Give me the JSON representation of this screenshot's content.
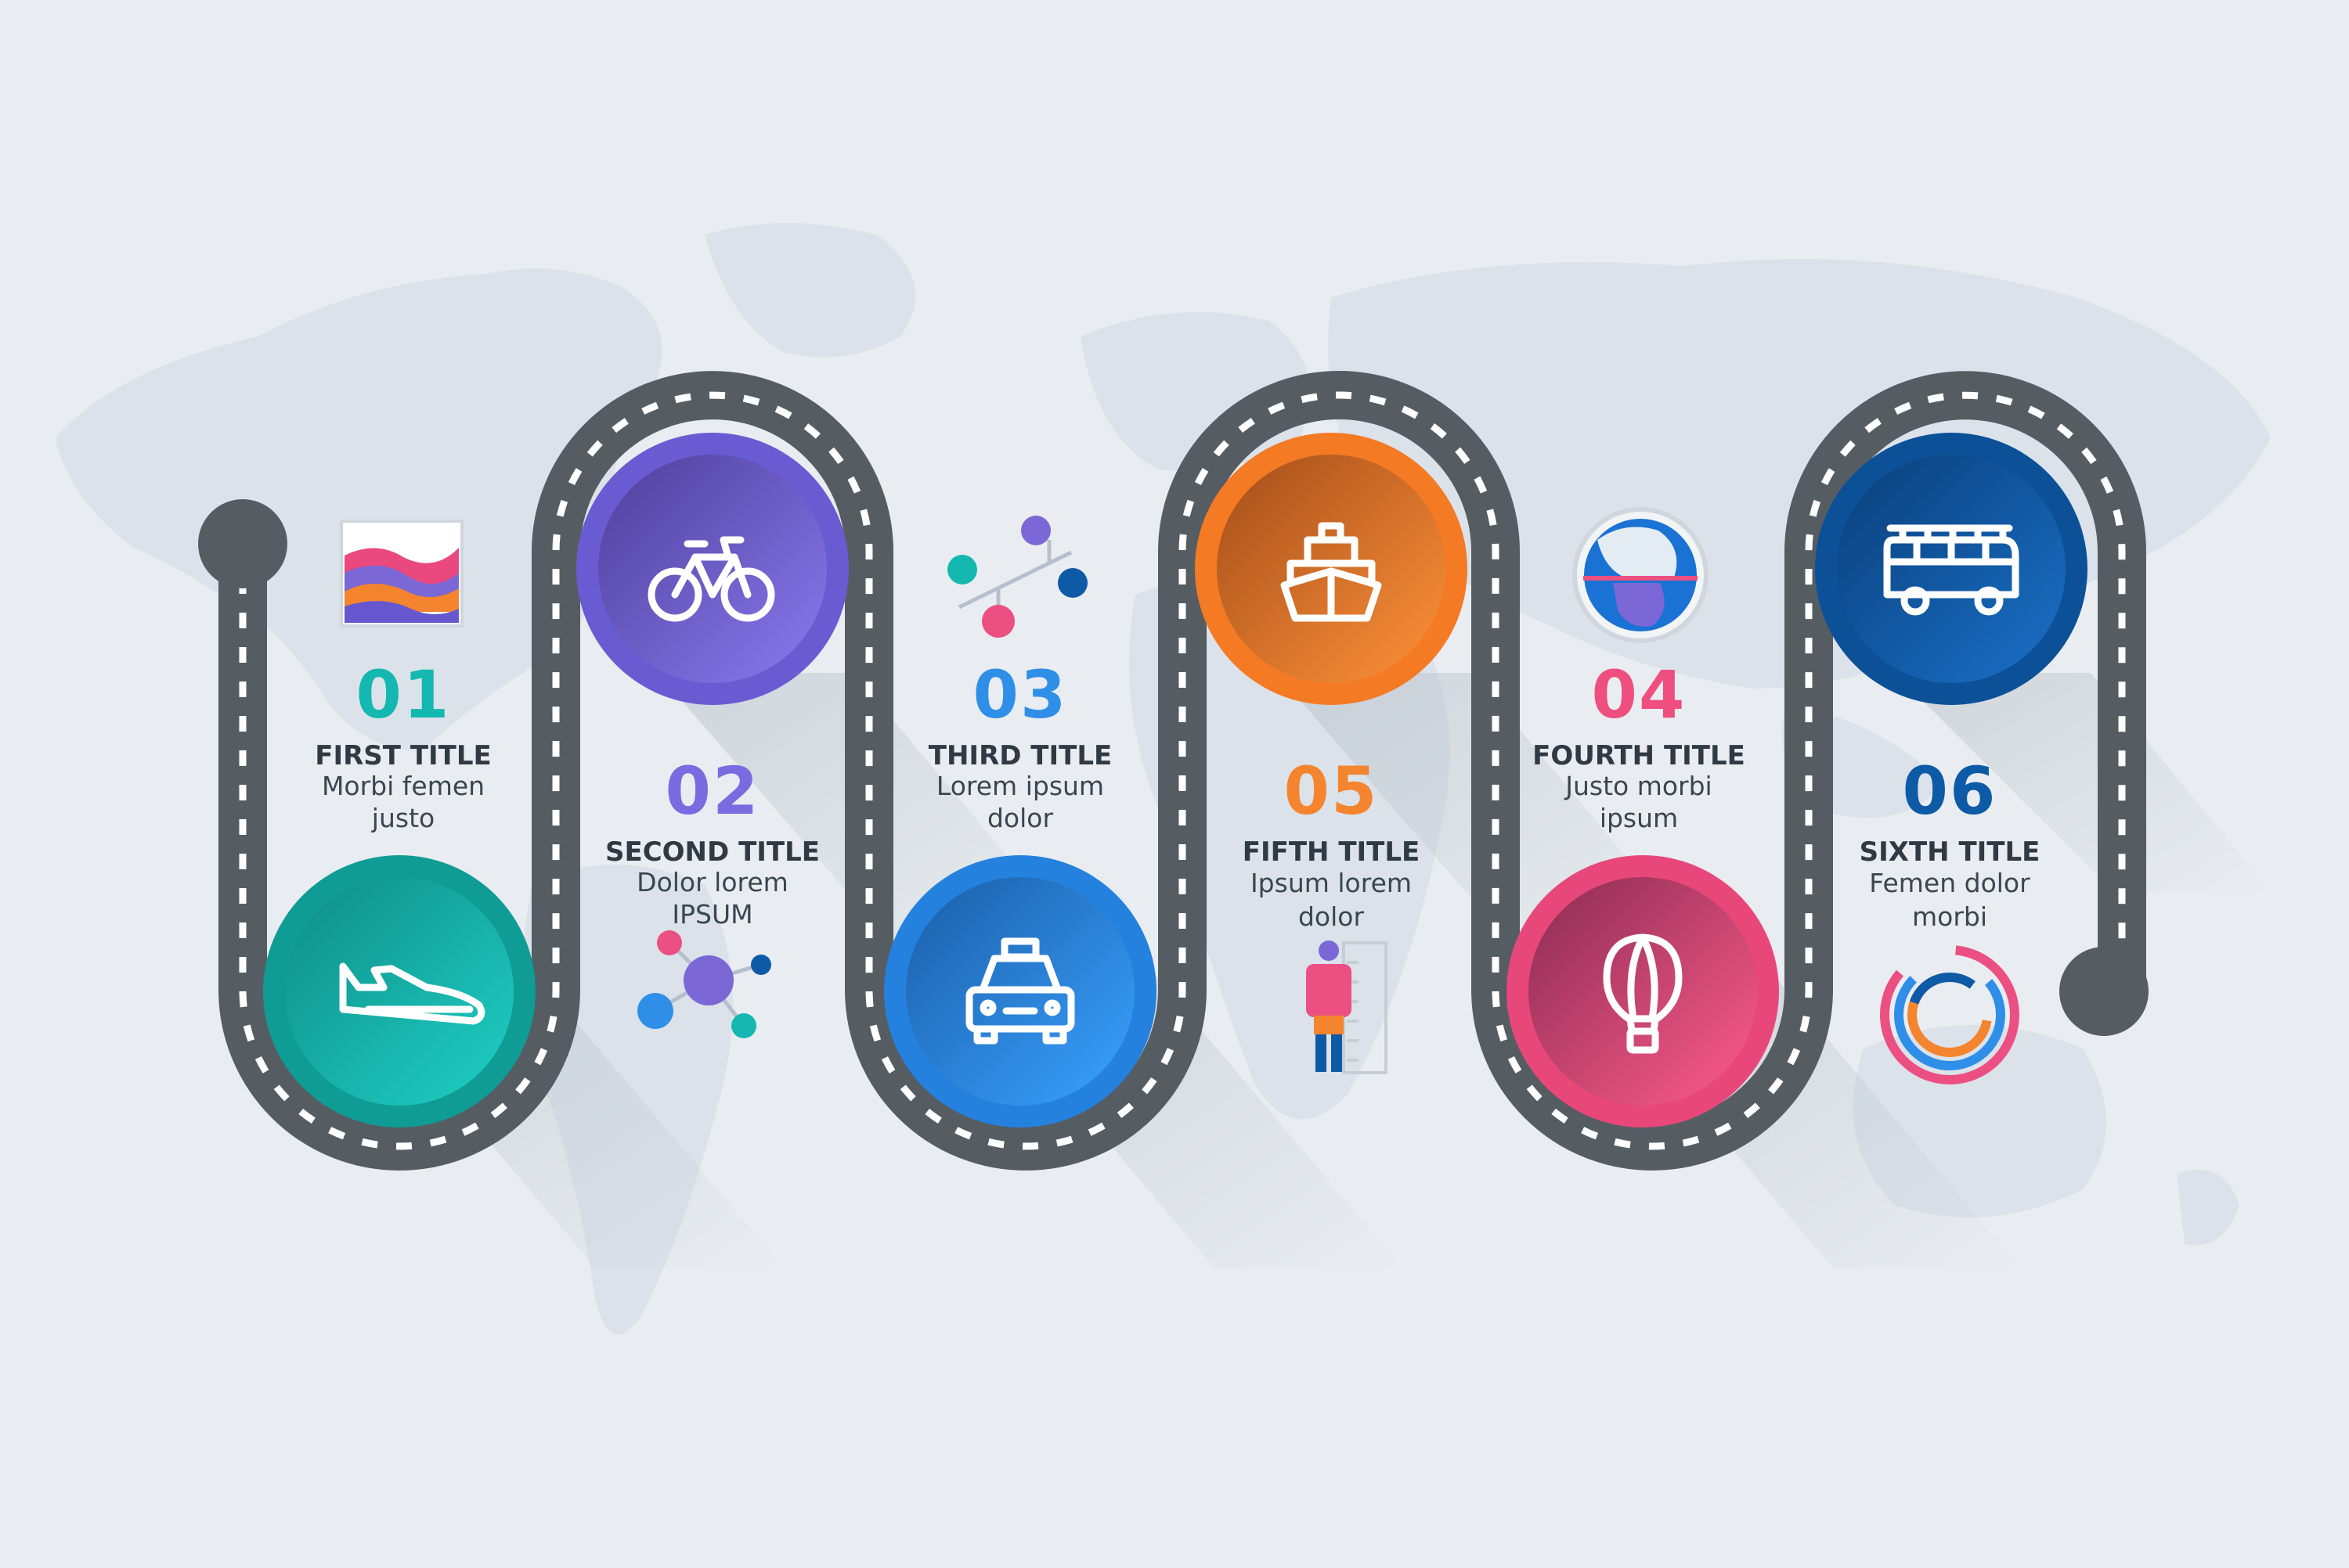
{
  "palette": {
    "background": "#e9edf1",
    "map": "#dbe2ea",
    "road": "#555d63",
    "road_dash": "#ffffff",
    "text_dark": "#2f3a44"
  },
  "steps": [
    {
      "number": "01",
      "title": "FIRST TITLE",
      "text": "Morbi femen\njusto",
      "color": "#14b8b0",
      "icon": "airplane-icon"
    },
    {
      "number": "02",
      "title": "SECOND TITLE",
      "text": "Dolor lorem\nIPSUM",
      "color": "#7a6be0",
      "icon": "bicycle-icon"
    },
    {
      "number": "03",
      "title": "THIRD TITLE",
      "text": "Lorem ipsum\ndolor",
      "color": "#2f8fe8",
      "icon": "taxi-icon"
    },
    {
      "number": "04",
      "title": "FOURTH TITLE",
      "text": "Justo morbi\nipsum",
      "color": "#ee4f7f",
      "icon": "hot-air-balloon-icon"
    },
    {
      "number": "05",
      "title": "FIFTH TITLE",
      "text": "Ipsum lorem\ndolor",
      "color": "#f5842e",
      "icon": "ship-icon"
    },
    {
      "number": "06",
      "title": "SIXTH TITLE",
      "text": "Femen dolor\nmorbi",
      "color": "#0d5aa7",
      "icon": "bus-icon"
    }
  ],
  "decorations": [
    "wave-chart-icon",
    "network-nodes-icon",
    "scatter-dots-icon",
    "globe-icon",
    "person-height-icon",
    "donut-ring-icon"
  ]
}
